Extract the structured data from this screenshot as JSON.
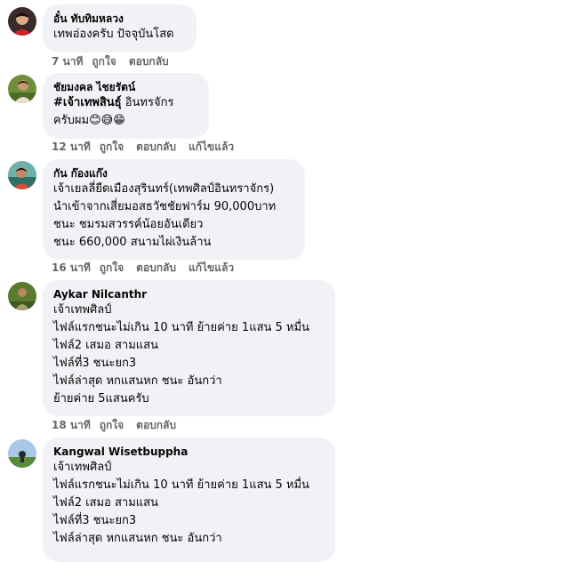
{
  "comments": [
    {
      "author": "อั๋น ทับทิมหลวง",
      "lines": [
        "เทพอ่องครับ ปัจจุบันโสด"
      ],
      "time": "7 นาที",
      "like": "ถูกใจ",
      "reply": "ตอบกลับ",
      "edited": ""
    },
    {
      "author": "ชัยมงคล ไชยรัตน์",
      "hashtag": "#เจ้าเทพสินธุ์",
      "line1_rest": " อินทรจักร",
      "line2_text": "ครับผม",
      "line2_emojis": "😊😅😁",
      "time": "12 นาที",
      "like": "ถูกใจ",
      "reply": "ตอบกลับ",
      "edited": "แก้ไขแล้ว"
    },
    {
      "author": "กัน ก๊องแก๊ง",
      "lines": [
        "เจ้าเยลลี่ยืดเมืองสุรินทร์(เทพศิลป์อินทราจักร)",
        "นำเข้าจากเสี่ยมอสธวัชชัยฟาร์ม 90,000บาท",
        "ชนะ ชมรมสวรรค์น้อยอันเดียว",
        "ชนะ 660,000 สนามไผ่เงินล้าน"
      ],
      "time": "16 นาที",
      "like": "ถูกใจ",
      "reply": "ตอบกลับ",
      "edited": "แก้ไขแล้ว"
    },
    {
      "author": "Aykar Nilcanthr",
      "lines": [
        "เจ้าเทพศิลป์",
        "ไฟล์แรกชนะไม่เกิน 10 นาที ย้ายค่าย 1แสน 5 หมื่น",
        "ไฟล์2 เสมอ สามแสน",
        "ไฟล์ที่3 ชนะยก3",
        "ไฟล์ล่าสุด หกแสนหก ชนะ อันกว่า",
        "ย้ายค่าย 5แสนครับ"
      ],
      "time": "18 นาที",
      "like": "ถูกใจ",
      "reply": "ตอบกลับ",
      "edited": ""
    },
    {
      "author": "Kangwal Wisetbuppha",
      "lines": [
        "เจ้าเทพศิลป์",
        "ไฟล์แรกชนะไม่เกิน 10 นาที ย้ายค่าย 1แสน 5 หมื่น",
        "ไฟล์2 เสมอ สามแสน",
        "ไฟล์ที่3 ชนะยก3",
        "ไฟล์ล่าสุด หกแสนหก ชนะ อันกว่า"
      ],
      "time": "",
      "like": "",
      "reply": "",
      "edited": ""
    }
  ]
}
